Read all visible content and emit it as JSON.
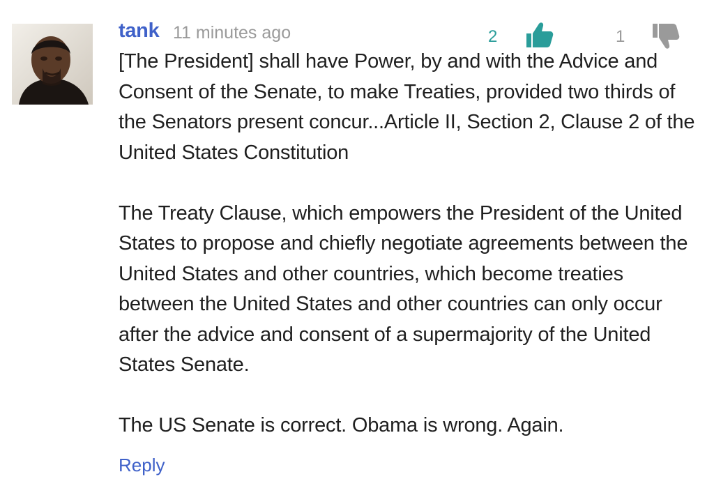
{
  "comment": {
    "author": "tank",
    "timestamp": "11 minutes ago",
    "likes": "2",
    "dislikes": "1",
    "paragraphs": [
      "[The President] shall have Power, by and with the Advice and Consent of the Senate, to make Treaties, provided two thirds of the Senators present concur...Article II, Section 2, Clause 2 of the United States Constitution",
      "The Treaty Clause, which empowers the President of the United States to propose and chiefly negotiate agreements between the United States and other countries, which become treaties between the United States and other countries can only occur after the advice and consent of a supermajority of the United States Senate.",
      "The US Senate is correct. Obama is wrong. Again."
    ],
    "reply_label": "Reply"
  },
  "icons": {
    "like": "thumbs-up-icon",
    "dislike": "thumbs-down-icon"
  },
  "colors": {
    "author": "#3f61c9",
    "timestamp": "#9a9a9a",
    "like": "#2a9d9a",
    "dislike": "#9a9a9a",
    "reply": "#3f61c9"
  }
}
